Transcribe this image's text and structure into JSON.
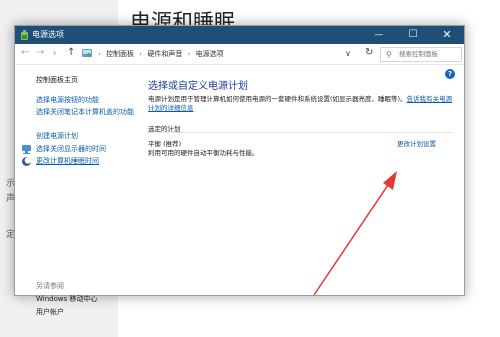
{
  "background": {
    "heading": "电源和睡眠",
    "marks": [
      "示",
      "声",
      "定"
    ]
  },
  "window": {
    "title": "电源选项",
    "controls": {
      "minimize": "—",
      "maximize": "☐",
      "close": "✕"
    }
  },
  "address": {
    "back": "←",
    "forward": "→",
    "dropdown": "∨",
    "up": "↑",
    "crumbs": [
      "控制面板",
      "硬件和声音",
      "电源选项"
    ],
    "crumb_separator": "›",
    "search_placeholder": "搜索控制面板"
  },
  "sidebar": {
    "home": "控制面板主页",
    "links": [
      "选择电源按钮的功能",
      "选择关闭笔记本计算机盖的功能",
      "创建电源计划",
      "选择关闭显示器的时间",
      "更改计算机睡眠时间"
    ],
    "see_also": "另请参阅",
    "see_also_items": [
      "Windows 移动中心",
      "用户帐户"
    ]
  },
  "main": {
    "title": "选择或自定义电源计划",
    "description": "电源计划是用于管理计算机如何使用电源的一套硬件和系统设置(如显示器亮度、睡眠等)。",
    "description_link": "告诉我有关电源计划的详细信息",
    "section_label": "选定的计划",
    "plan_name": "平衡 (推荐)",
    "plan_description": "利用可用的硬件自动平衡功耗与性能。",
    "plan_change_link": "更改计划设置"
  },
  "colors": {
    "titlebar": "#1f4e79",
    "link": "#0b5cad",
    "heading": "#1e3d8f",
    "annotation_arrow": "#e53935"
  }
}
